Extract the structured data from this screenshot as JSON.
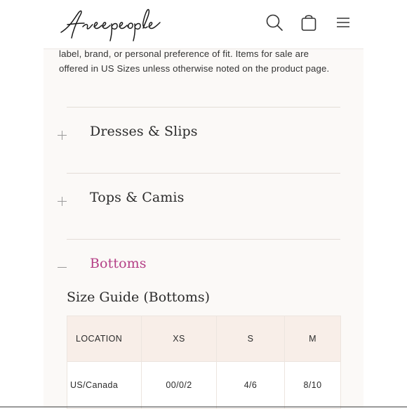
{
  "header": {
    "logo_text": "free people",
    "search_icon": "search-icon",
    "bag_icon": "shopping-bag-icon",
    "menu_icon": "hamburger-menu-icon"
  },
  "intro": {
    "line1": "label, brand, or personal preference of fit. Items for sale are",
    "line2": "offered in US Sizes unless otherwise noted on the product page."
  },
  "accordion": [
    {
      "label": "Dresses & Slips",
      "state": "+"
    },
    {
      "label": "Tops & Camis",
      "state": "+"
    },
    {
      "label": "Bottoms",
      "state": "—"
    }
  ],
  "size_guide": {
    "title": "Size Guide (Bottoms)",
    "headers": [
      "LOCATION",
      "XS",
      "S",
      "M"
    ],
    "rows": [
      [
        "US/Canada",
        "00/0/2",
        "4/6",
        "8/10"
      ]
    ]
  },
  "colors": {
    "active_accent": "#b43f86",
    "table_header_bg": "#f8eee8",
    "page_bg": "#fbf9f7"
  }
}
